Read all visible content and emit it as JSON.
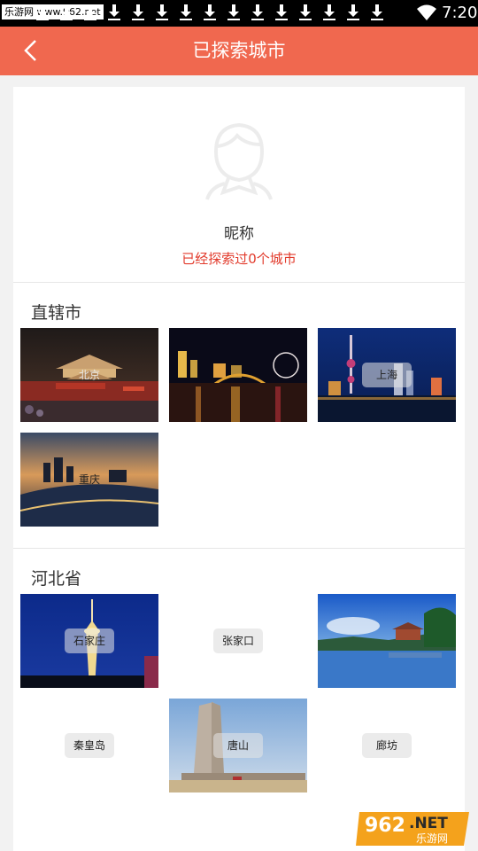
{
  "status_bar": {
    "watermark": "乐游网 www.962.net",
    "time": "7:20",
    "download_icons": [
      "download-icon",
      "download-icon",
      "download-icon",
      "download-icon",
      "download-icon",
      "download-icon",
      "download-icon",
      "download-icon",
      "download-icon",
      "download-icon",
      "download-icon",
      "download-icon",
      "download-icon",
      "download-icon",
      "download-icon"
    ],
    "wifi_icon": "wifi-icon"
  },
  "header": {
    "back_icon": "chevron-left-icon",
    "title": "已探索城市",
    "bar_color": "#f0684f"
  },
  "profile": {
    "avatar_icon": "user-avatar-icon",
    "nickname": "昵称",
    "explored_text": "已经探索过0个城市",
    "explored_color": "#e23b2c"
  },
  "sections": [
    {
      "title": "直辖市",
      "cities": [
        {
          "label": "北京",
          "has_image": true
        },
        {
          "label": "",
          "has_image": true
        },
        {
          "label": "上海",
          "has_image": true
        },
        {
          "label": "重庆",
          "has_image": true
        }
      ]
    },
    {
      "title": "河北省",
      "cities": [
        {
          "label": "石家庄",
          "has_image": true
        },
        {
          "label": "张家口",
          "has_image": false
        },
        {
          "label": "",
          "has_image": true
        },
        {
          "label": "秦皇岛",
          "has_image": false
        },
        {
          "label": "唐山",
          "has_image": true
        },
        {
          "label": "廊坊",
          "has_image": false
        }
      ]
    }
  ],
  "footer": {
    "logo_number": "962",
    "logo_suffix": ".NET",
    "logo_cn": "乐游网"
  }
}
